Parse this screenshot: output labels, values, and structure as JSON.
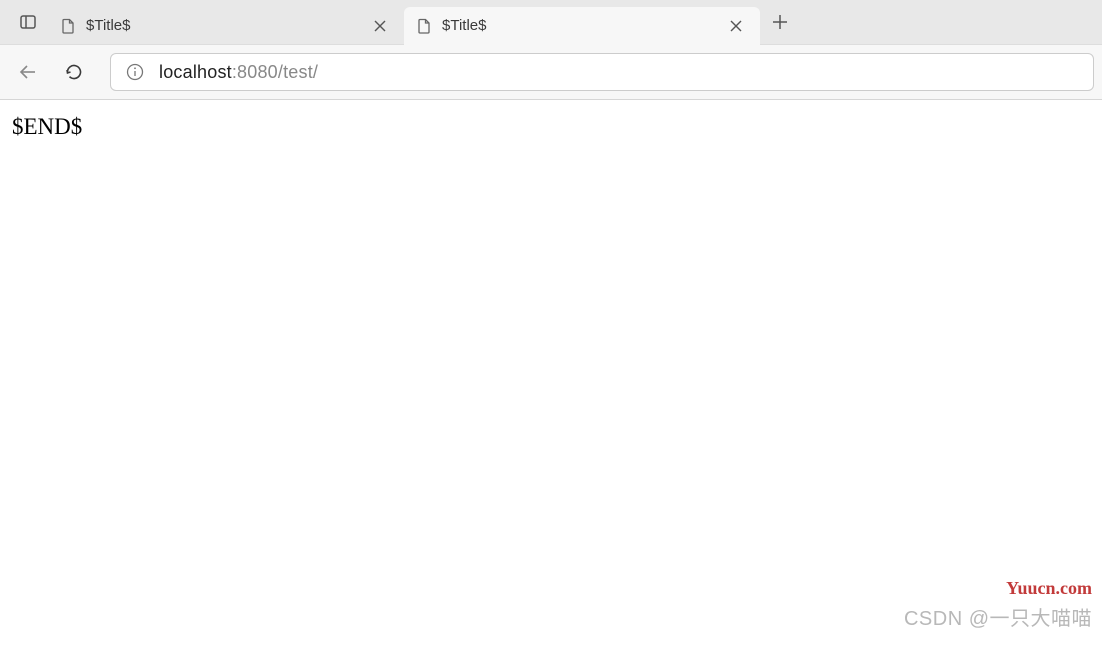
{
  "tabs": [
    {
      "title": "$Title$",
      "active": false
    },
    {
      "title": "$Title$",
      "active": true
    }
  ],
  "url": {
    "host": "localhost",
    "port": ":8080",
    "path": "/test/"
  },
  "page": {
    "body_text": "$END$"
  },
  "watermark": {
    "site": "Yuucn.com",
    "attribution": "CSDN @一只大喵喵"
  }
}
